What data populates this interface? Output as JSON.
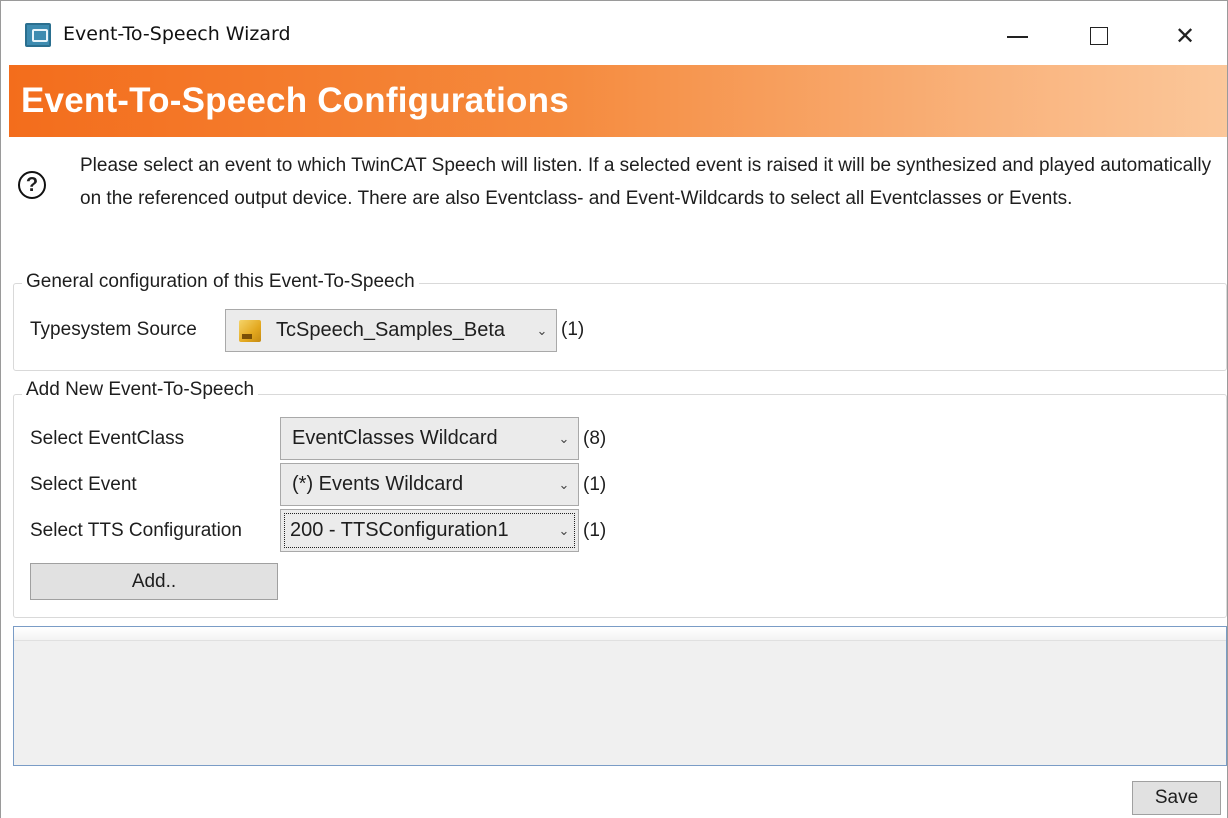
{
  "window": {
    "title": "Event-To-Speech Wizard",
    "controls": [
      "minimize",
      "maximize",
      "close"
    ],
    "close_glyph": "✕"
  },
  "banner": {
    "title": "Event-To-Speech Configurations",
    "colors": {
      "start": "#f36d1c",
      "end": "#fbc79a"
    }
  },
  "help": {
    "icon": "question-circle-icon",
    "icon_glyph": "?",
    "description": "Please select an event to which TwinCAT Speech will listen. If a selected event is raised it will be synthesized and played automatically on the referenced output device. There are also Eventclass- and Event-Wildcards to select all Eventclasses or Events."
  },
  "general": {
    "legend": "General configuration of this Event-To-Speech",
    "typesystem_label": "Typesystem Source",
    "typesystem_value": "TcSpeech_Samples_Beta",
    "typesystem_count": "(1)"
  },
  "add_new": {
    "legend": "Add New Event-To-Speech",
    "eventclass_label": "Select EventClass",
    "eventclass_value": "EventClasses Wildcard",
    "eventclass_count": "(8)",
    "event_label": "Select Event",
    "event_value": "(*) Events Wildcard",
    "event_count": "(1)",
    "tts_label": "Select TTS Configuration",
    "tts_value": "200 - TTSConfiguration1",
    "tts_count": "(1)",
    "add_button": "Add.."
  },
  "footer": {
    "save_button": "Save"
  },
  "chevron_glyph": "⌄"
}
